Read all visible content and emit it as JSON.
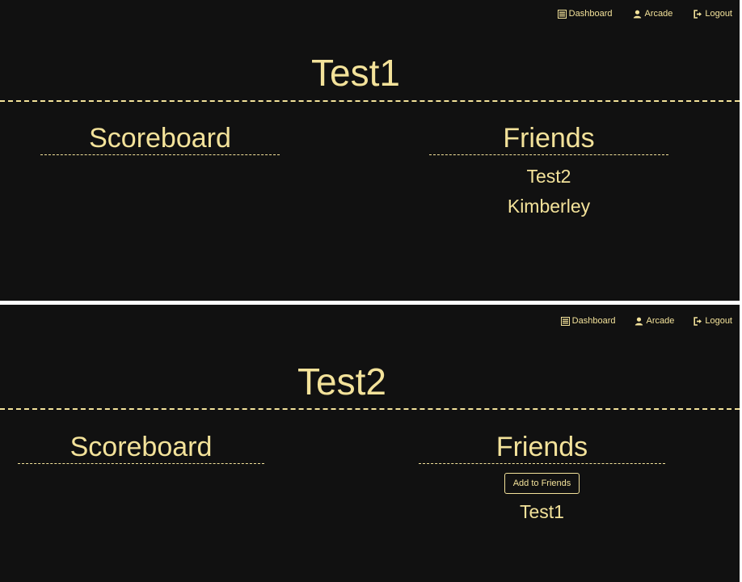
{
  "panels": [
    {
      "nav": {
        "dashboard": "Dashboard",
        "arcade": "Arcade",
        "logout": "Logout"
      },
      "title": "Test1",
      "scoreboard": {
        "title": "Scoreboard"
      },
      "friends": {
        "title": "Friends",
        "items": [
          "Test2",
          "Kimberley"
        ]
      }
    },
    {
      "nav": {
        "dashboard": "Dashboard",
        "arcade": "Arcade",
        "logout": "Logout"
      },
      "title": "Test2",
      "scoreboard": {
        "title": "Scoreboard"
      },
      "friends": {
        "title": "Friends",
        "add_button": "Add to Friends",
        "items": [
          "Test1"
        ]
      }
    }
  ],
  "colors": {
    "accent": "#f3e29a",
    "background": "#111111",
    "separator": "#ffffff"
  }
}
